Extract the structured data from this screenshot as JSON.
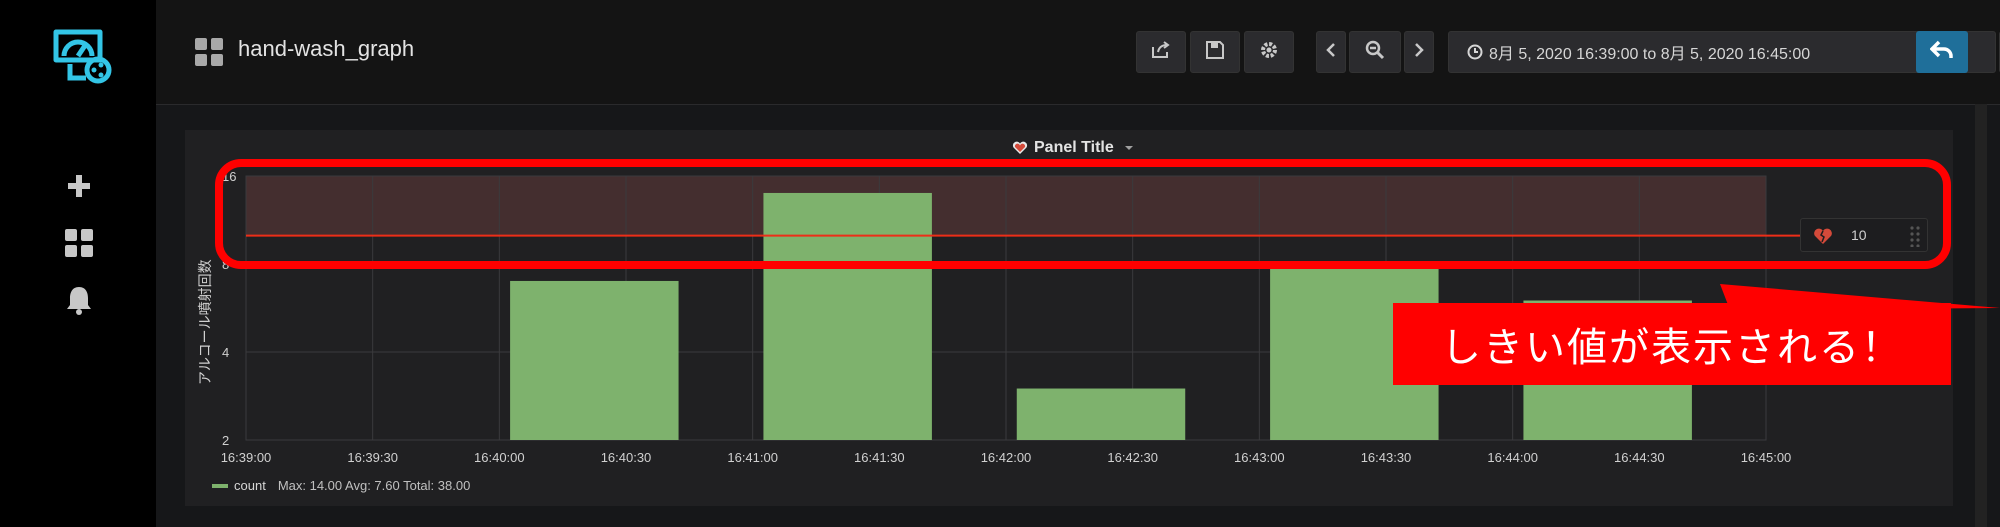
{
  "topbar": {
    "title": "hand-wash_graph",
    "time_range": "8月 5, 2020 16:39:00 to 8月 5, 2020 16:45:00"
  },
  "icons": {
    "logo": "grafana-logo-icon",
    "add": "plus-icon",
    "dashboards": "dashboard-grid-icon",
    "alerts": "bell-icon",
    "share": "share-icon",
    "save": "save-icon",
    "settings": "gear-icon",
    "prev": "chevron-left-icon",
    "zoom_out": "zoom-out-icon",
    "next": "chevron-right-icon",
    "clock": "clock-icon",
    "refresh": "refresh-icon",
    "back": "back-arrow-icon",
    "panel_heart": "heart-icon",
    "threshold_heart": "broken-heart-icon"
  },
  "panel": {
    "title": "Panel Title",
    "ylabel": "アルコール噴射回数",
    "threshold_value": "10"
  },
  "chart_data": {
    "type": "bar",
    "ylabel": "アルコール噴射回数",
    "y_scale": "log2",
    "ylim": [
      2,
      16
    ],
    "y_ticks": [
      {
        "value": 2,
        "label": "2"
      },
      {
        "value": 4,
        "label": "4"
      },
      {
        "value": 8,
        "label": "8"
      },
      {
        "value": 16,
        "label": "16"
      }
    ],
    "x_ticks": [
      "16:39:00",
      "16:39:30",
      "16:40:00",
      "16:40:30",
      "16:41:00",
      "16:41:30",
      "16:42:00",
      "16:42:30",
      "16:43:00",
      "16:43:30",
      "16:44:00",
      "16:44:30",
      "16:45:00"
    ],
    "xlim": [
      "16:39:00",
      "16:45:00"
    ],
    "x": [
      "16:40:00",
      "16:41:00",
      "16:42:00",
      "16:43:00",
      "16:44:00"
    ],
    "series": [
      {
        "name": "count",
        "values": [
          7,
          14,
          3,
          8,
          6
        ],
        "color": "#7eb26d"
      }
    ],
    "threshold": {
      "value": 10,
      "op": "gt",
      "color": "#ed2e18"
    },
    "grid": true,
    "legend": {
      "position": "bottom-left",
      "series": "count",
      "stats": "Max: 14.00  Avg: 7.60  Total: 38.00"
    }
  },
  "annotation": {
    "text": "しきい値が表示される！",
    "color": "#ff0000"
  }
}
